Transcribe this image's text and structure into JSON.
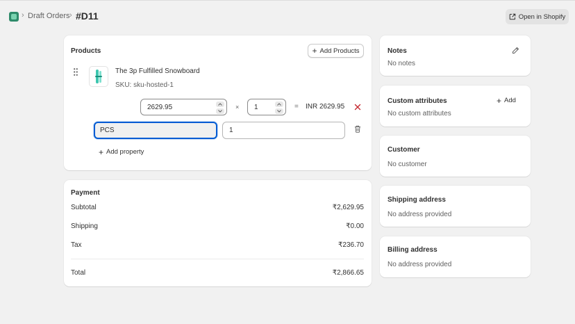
{
  "breadcrumb": {
    "parent_label": "Draft Orders",
    "separator": "›",
    "current_label": "#D11"
  },
  "header": {
    "open_button_label": "Open in Shopify"
  },
  "products": {
    "title": "Products",
    "add_button_label": "Add Products",
    "item": {
      "name": "The 3p Fulfilled Snowboard",
      "sku": "SKU: sku-hosted-1",
      "price_value": "2629.95",
      "multiply_symbol": "×",
      "quantity_value": "1",
      "equals_symbol": "=",
      "line_total": "INR 2629.95"
    },
    "property": {
      "name_value": "PCS",
      "value_value": "1"
    },
    "add_property_label": "Add property"
  },
  "payment": {
    "title": "Payment",
    "rows": [
      {
        "label": "Subtotal",
        "value": "₹2,629.95"
      },
      {
        "label": "Shipping",
        "value": "₹0.00"
      },
      {
        "label": "Tax",
        "value": "₹236.70"
      }
    ],
    "total_label": "Total",
    "total_value": "₹2,866.65"
  },
  "notes": {
    "title": "Notes",
    "text": "No notes"
  },
  "custom_attributes": {
    "title": "Custom attributes",
    "add_label": "Add",
    "text": "No custom attributes"
  },
  "customer": {
    "title": "Customer",
    "text": "No customer"
  },
  "shipping_address": {
    "title": "Shipping address",
    "text": "No address provided"
  },
  "billing_address": {
    "title": "Billing address",
    "text": "No address provided"
  },
  "colors": {
    "accent": "#005bd3",
    "remove": "#c5282f",
    "product_thumb": "#3ec7b0"
  }
}
